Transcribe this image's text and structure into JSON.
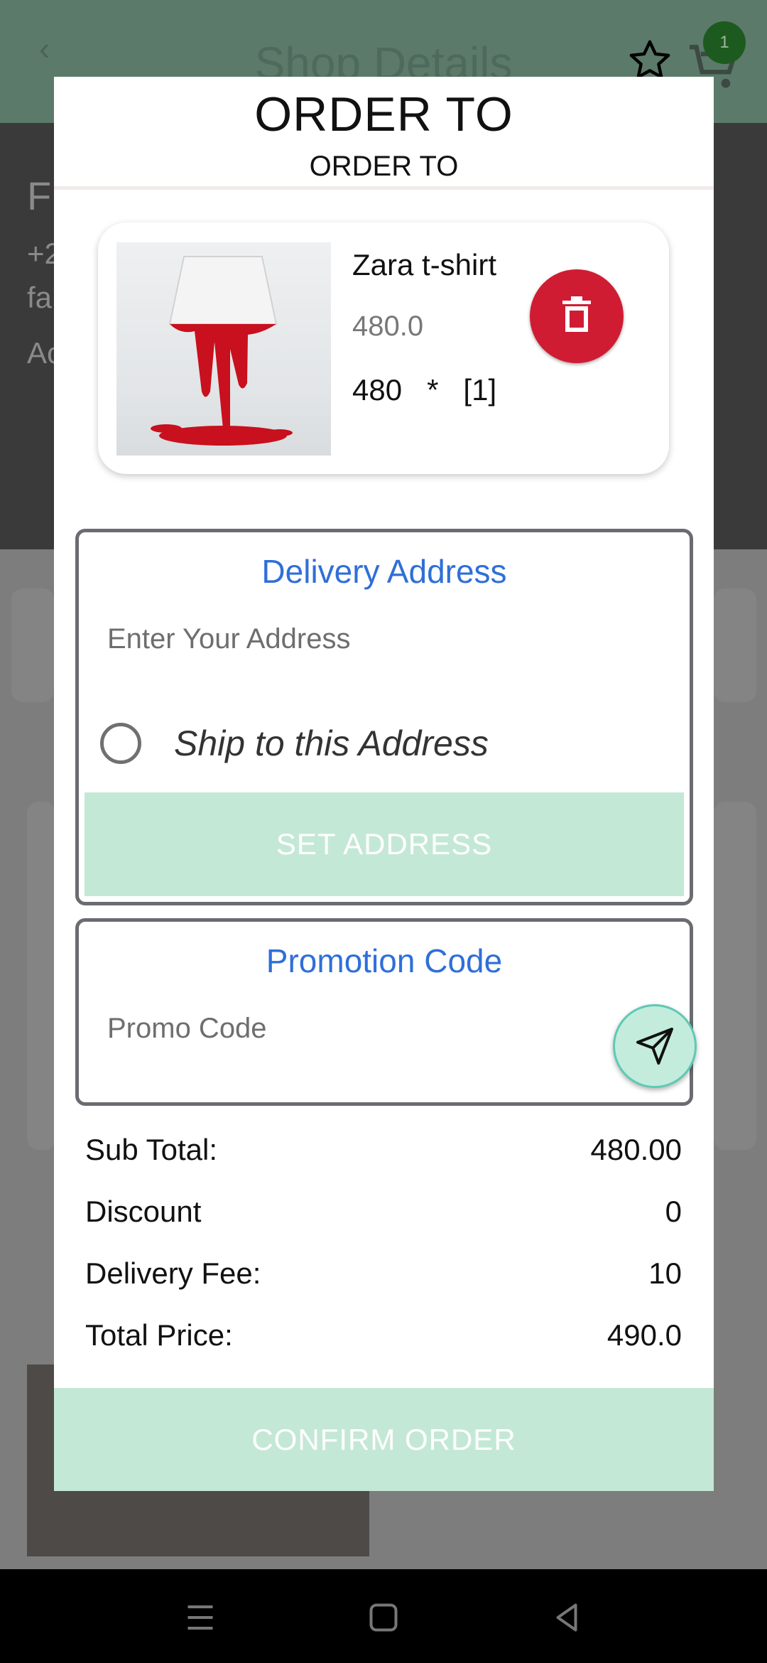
{
  "background": {
    "title": "Shop Details",
    "cart_count": "1"
  },
  "dialog": {
    "title": "ORDER TO",
    "subtitle": "ORDER TO",
    "item": {
      "name": "Zara t-shirt",
      "price": "480.0",
      "qty_line": "480   *   [1]"
    },
    "delivery": {
      "title": "Delivery Address",
      "address_placeholder": "Enter Your Address",
      "ship_label": "Ship to this Address",
      "set_button": "SET ADDRESS"
    },
    "promo": {
      "title": "Promotion Code",
      "placeholder": "Promo Code"
    },
    "summary": [
      {
        "label": "Sub Total:",
        "value": "480.00"
      },
      {
        "label": "Discount",
        "value": "0"
      },
      {
        "label": "Delivery Fee:",
        "value": "10"
      },
      {
        "label": "Total Price:",
        "value": "490.0"
      }
    ],
    "confirm_button": "CONFIRM ORDER"
  },
  "colors": {
    "accent_blue": "#2f6fd8",
    "delete_red": "#d01c33",
    "button_mint": "#c4e8d6"
  }
}
